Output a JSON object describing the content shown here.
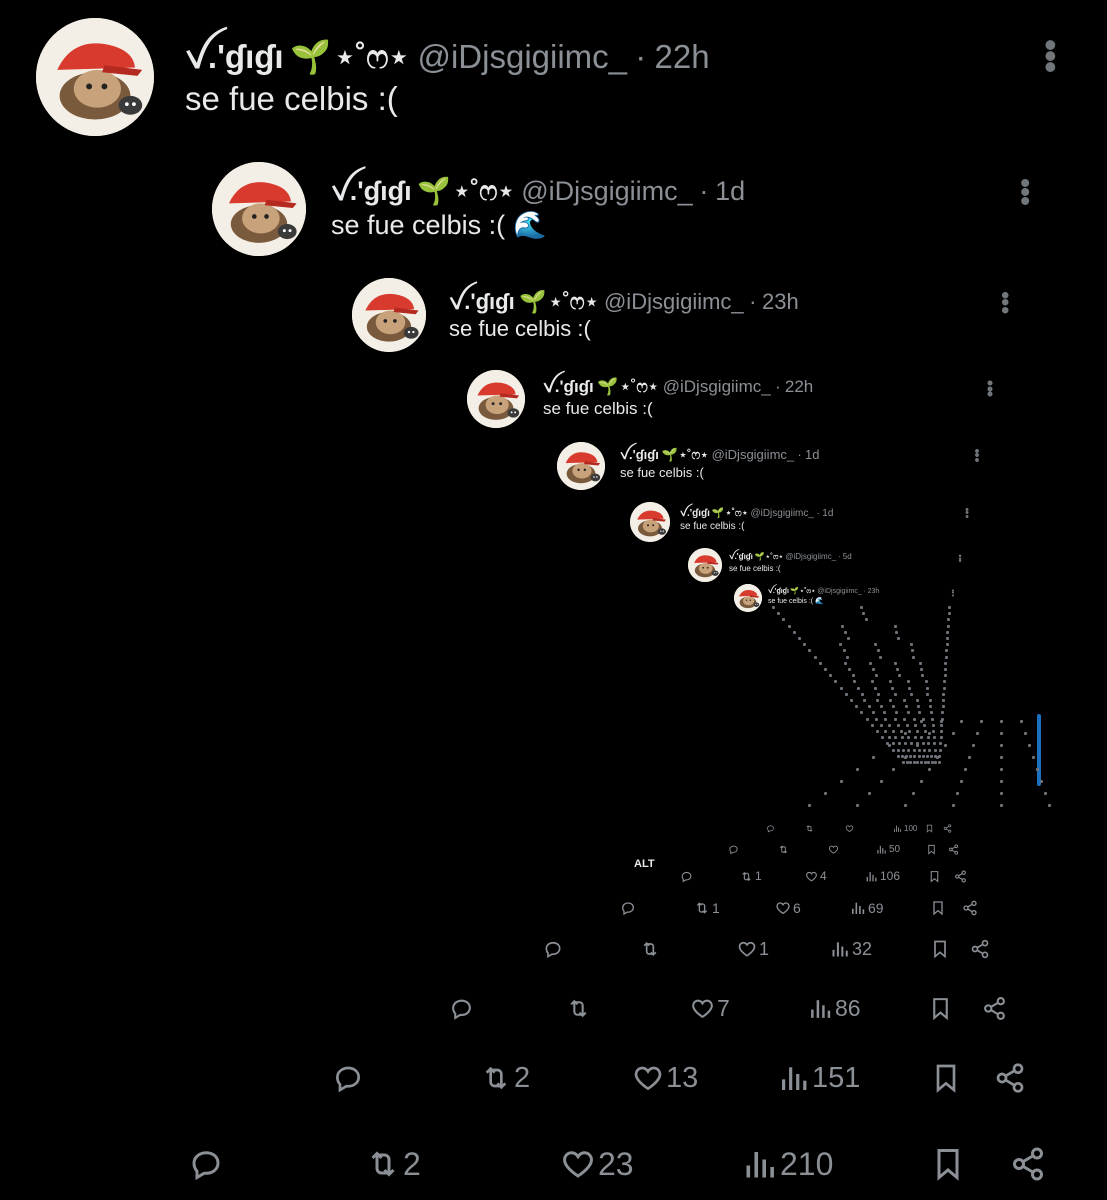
{
  "posts": [
    {
      "name": "ꪜ.'ɠıɠı",
      "sprout": "🌱",
      "deco": "⋆˚ෆ⋆",
      "handle": "@iDjsgigiimc_",
      "dot": "·",
      "time": "22h",
      "text": "se fue celbis :(",
      "reply": "",
      "retweets": "2",
      "likes": "23",
      "views": "210"
    },
    {
      "name": "ꪜ.'ɠıɠı",
      "sprout": "🌱",
      "deco": "⋆˚ෆ⋆",
      "handle": "@iDjsgigiimc_",
      "dot": "·",
      "time": "1d",
      "text": "se fue celbis :(",
      "emoji": "🌊",
      "reply": "",
      "retweets": "2",
      "likes": "13",
      "views": "151"
    },
    {
      "name": "ꪜ.'ɠıɠı",
      "sprout": "🌱",
      "deco": "⋆˚ෆ⋆",
      "handle": "@iDjsgigiimc_",
      "dot": "·",
      "time": "23h",
      "text": "se fue celbis :(",
      "reply": "",
      "retweets": "",
      "likes": "7",
      "views": "86"
    },
    {
      "name": "ꪜ.'ɠıɠı",
      "sprout": "🌱",
      "deco": "⋆˚ෆ⋆",
      "handle": "@iDjsgigiimc_",
      "dot": "·",
      "time": "22h",
      "text": "se fue celbis :(",
      "reply": "",
      "retweets": "",
      "likes": "1",
      "views": "32"
    },
    {
      "name": "ꪜ.'ɠıɠı",
      "sprout": "🌱",
      "deco": "⋆˚ෆ⋆",
      "handle": "@iDjsgigiimc_",
      "dot": "·",
      "time": "1d",
      "text": "se fue celbis :(",
      "reply": "",
      "retweets": "1",
      "likes": "6",
      "views": "69"
    },
    {
      "name": "ꪜ.'ɠıɠı",
      "sprout": "🌱",
      "deco": "⋆˚ෆ⋆",
      "handle": "@iDjsgigiimc_",
      "dot": "·",
      "time": "1d",
      "text": "se fue celbis :(",
      "reply": "",
      "retweets": "1",
      "likes": "4",
      "views": "106"
    },
    {
      "name": "ꪜ.'ɠıɠı",
      "sprout": "🌱",
      "deco": "⋆˚ෆ⋆",
      "handle": "@iDjsgigiimc_",
      "dot": "·",
      "time": "5d",
      "text": "se fue celbis :(",
      "reply": "",
      "retweets": "",
      "likes": "",
      "views": "50"
    },
    {
      "name": "ꪜ.'ɠıɠı",
      "sprout": "🌱",
      "deco": "⋆˚ෆ⋆",
      "handle": "@iDjsgigiimc_",
      "dot": "·",
      "time": "23h",
      "text": "se fue celbis :(",
      "emoji": "🌊",
      "reply": "",
      "retweets": "",
      "likes": "",
      "views": "100"
    }
  ],
  "alt_badge": "ALT",
  "icons": {
    "reply": "reply-icon",
    "retweet": "retweet-icon",
    "like": "heart-icon",
    "views": "views-icon",
    "bookmark": "bookmark-icon",
    "share": "share-icon",
    "menu": "more-icon"
  },
  "colors": {
    "background": "#000000",
    "text": "#e7e9ea",
    "muted": "#8b9096",
    "sprout": "#5cc04a",
    "scrollbar": "#1d6fc0"
  }
}
